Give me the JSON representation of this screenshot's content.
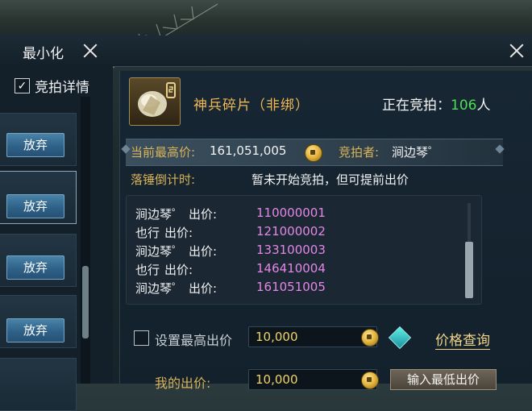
{
  "window": {
    "minimize_label": "最小化",
    "left_close_icon": "close-icon",
    "right_close_icon": "close-icon"
  },
  "sidebar": {
    "detail_toggle": {
      "label": "竞拍详情",
      "checked": true,
      "check_mark": "✓"
    },
    "items": [
      {
        "button_label": "放弃"
      },
      {
        "button_label": "放弃"
      },
      {
        "button_label": "放弃"
      },
      {
        "button_label": "放弃"
      }
    ]
  },
  "item": {
    "name": "神兵碎片（非绑）",
    "icon": "shard-item-icon",
    "bidders_label": "正在竞拍：",
    "bidders_count": "106",
    "bidders_unit": "人"
  },
  "price": {
    "highest_label": "当前最高价:",
    "highest_value": "161,051,005",
    "currency_icon": "coin-icon",
    "bidder_label": "竞拍者:",
    "bidder_name": "涧边琴゜"
  },
  "countdown": {
    "label": "落锤倒计时:",
    "text": "暂未开始竞拍，但可提前出价"
  },
  "bid_log": [
    {
      "name": "涧边琴゜",
      "word": "出价:",
      "amount": "110000001"
    },
    {
      "name": "也行",
      "word": "出价:",
      "amount": "121000002"
    },
    {
      "name": "涧边琴゜",
      "word": "出价:",
      "amount": "133100003"
    },
    {
      "name": "也行",
      "word": "出价:",
      "amount": "146410004"
    },
    {
      "name": "涧边琴゜",
      "word": "出价:",
      "amount": "161051005"
    }
  ],
  "controls": {
    "max_bid_label": "设置最高出价",
    "max_bid_value": "10,000",
    "max_bid_checked": false,
    "price_query_label": "价格查询",
    "my_bid_label": "我的出价:",
    "my_bid_value": "10,000",
    "min_bid_button": "输入最低出价"
  },
  "colors": {
    "item_name": "#f0b955",
    "bidder_count": "#4fdc57",
    "bid_amount": "#e387e6",
    "label_gold": "#d8b35a"
  }
}
